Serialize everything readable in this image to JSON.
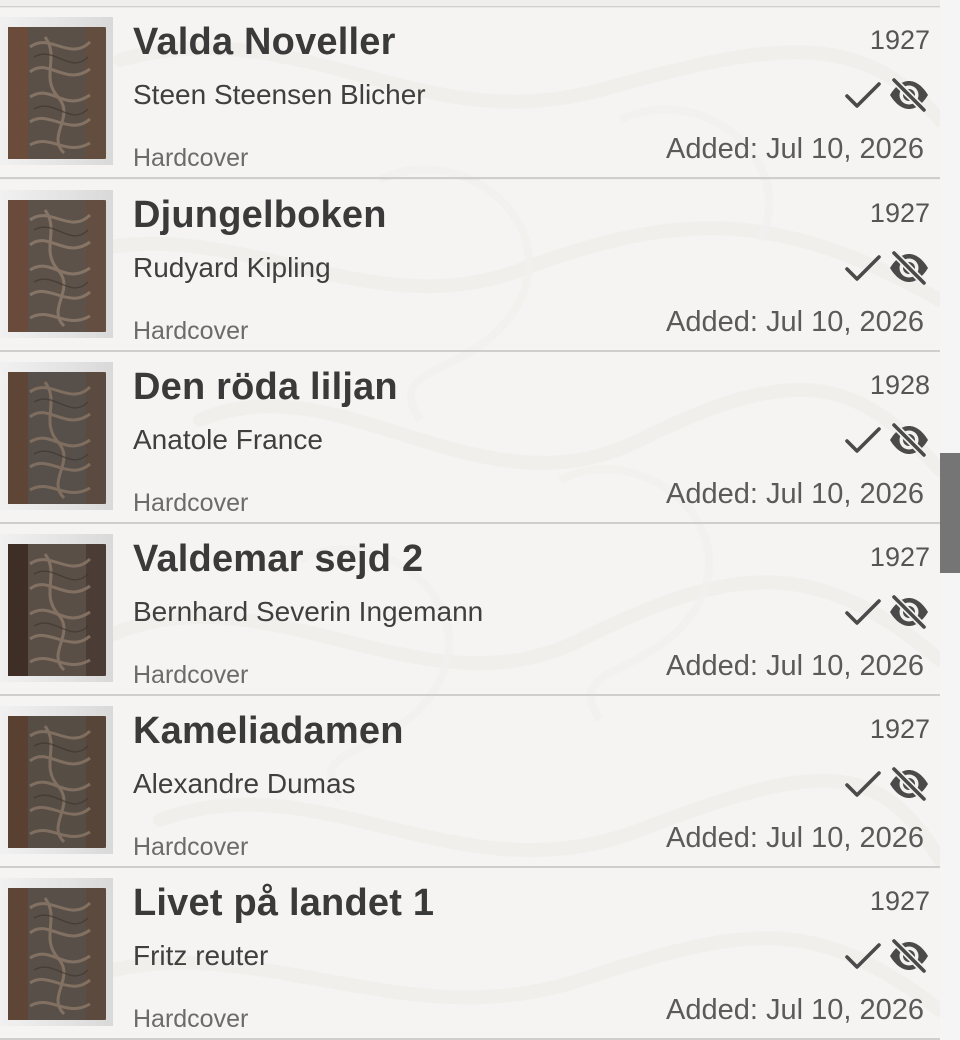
{
  "colors": {
    "background": "#f0efee",
    "title_text": "#3a3a3a",
    "icon": "#4a4a4a",
    "scroll_thumb": "#757575"
  },
  "books": [
    {
      "title": "Valda Noveller",
      "author": "Steen Steensen Blicher",
      "format": "Hardcover",
      "year": "1927",
      "added": "Added: Jul 10, 2026",
      "read_icon": "check-icon",
      "visibility_icon": "eye-off-icon"
    },
    {
      "title": "Djungelboken",
      "author": "Rudyard Kipling",
      "format": "Hardcover",
      "year": "1927",
      "added": "Added: Jul 10, 2026",
      "read_icon": "check-icon",
      "visibility_icon": "eye-off-icon"
    },
    {
      "title": "Den röda liljan",
      "author": "Anatole France",
      "format": "Hardcover",
      "year": "1928",
      "added": "Added: Jul 10, 2026",
      "read_icon": "check-icon",
      "visibility_icon": "eye-off-icon"
    },
    {
      "title": "Valdemar sejd 2",
      "author": "Bernhard Severin Ingemann",
      "format": "Hardcover",
      "year": "1927",
      "added": "Added: Jul 10, 2026",
      "read_icon": "check-icon",
      "visibility_icon": "eye-off-icon"
    },
    {
      "title": "Kameliadamen",
      "author": "Alexandre Dumas",
      "format": "Hardcover",
      "year": "1927",
      "added": "Added: Jul 10, 2026",
      "read_icon": "check-icon",
      "visibility_icon": "eye-off-icon"
    },
    {
      "title": "Livet på landet 1",
      "author": "Fritz reuter",
      "format": "Hardcover",
      "year": "1927",
      "added": "Added: Jul 10, 2026",
      "read_icon": "check-icon",
      "visibility_icon": "eye-off-icon"
    }
  ]
}
